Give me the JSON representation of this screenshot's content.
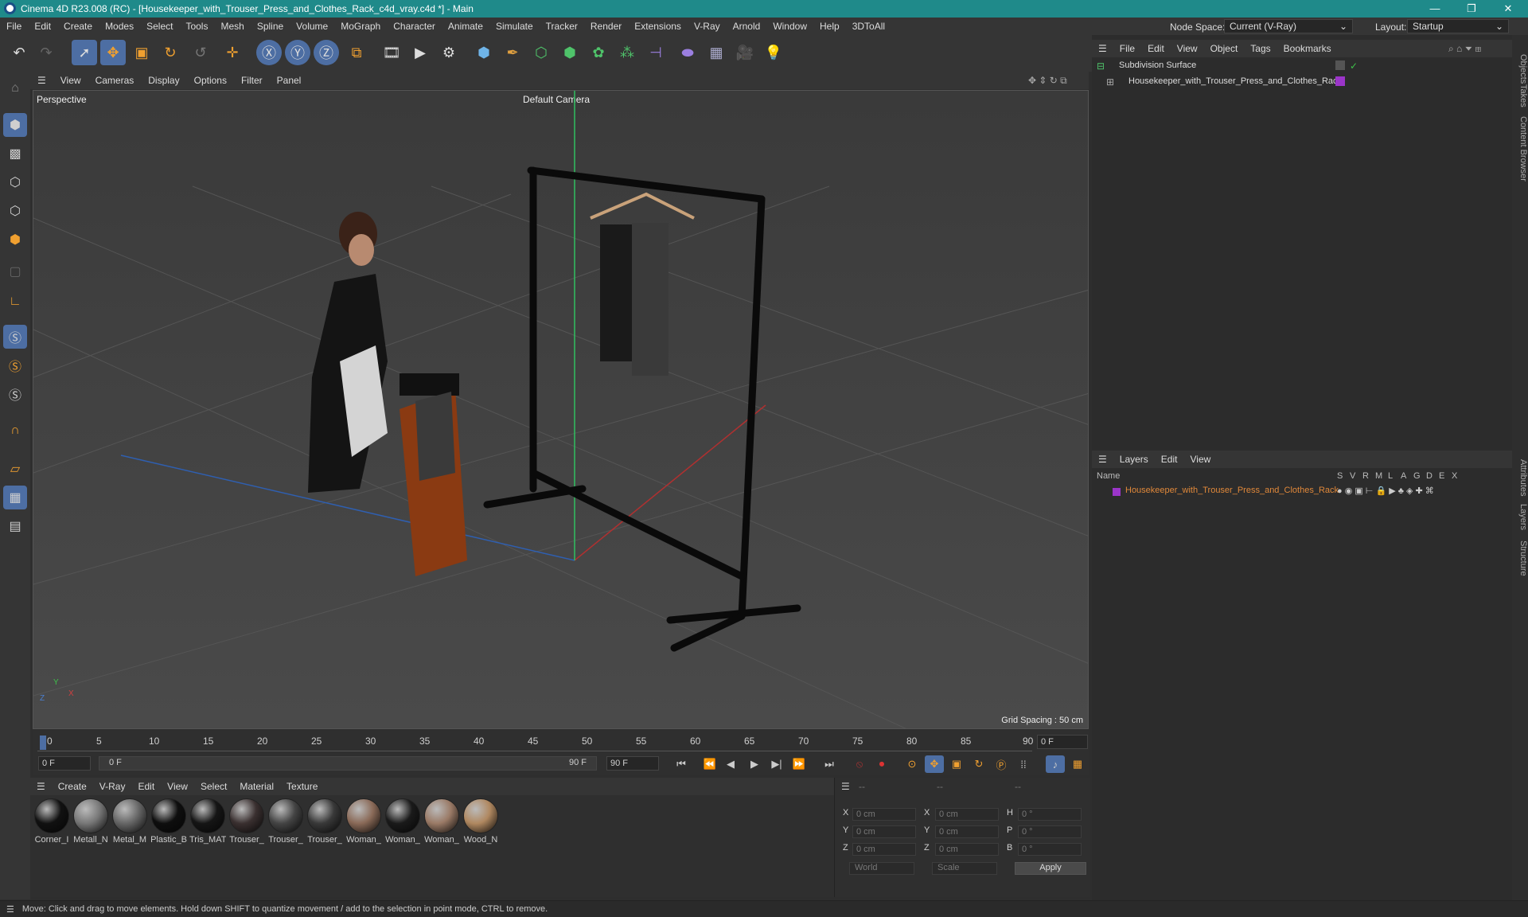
{
  "window": {
    "title": "Cinema 4D R23.008 (RC) - [Housekeeper_with_Trouser_Press_and_Clothes_Rack_c4d_vray.c4d *] - Main",
    "minimize": "—",
    "maximize": "❐",
    "close": "✕"
  },
  "menubar": {
    "items": [
      "File",
      "Edit",
      "Create",
      "Modes",
      "Select",
      "Tools",
      "Mesh",
      "Spline",
      "Volume",
      "MoGraph",
      "Character",
      "Animate",
      "Simulate",
      "Tracker",
      "Render",
      "Extensions",
      "V-Ray",
      "Arnold",
      "Window",
      "Help",
      "3DToAll"
    ],
    "node_space_label": "Node Space:",
    "node_space_value": "Current (V-Ray)",
    "layout_label": "Layout:",
    "layout_value": "Startup"
  },
  "viewport": {
    "menu": [
      "View",
      "Cameras",
      "Display",
      "Options",
      "Filter",
      "Panel"
    ],
    "name": "Perspective",
    "camera": "Default Camera",
    "grid_spacing": "Grid Spacing : 50 cm",
    "axis_y": "Y",
    "axis_x": "X",
    "axis_z": "Z"
  },
  "timeline": {
    "ticks": [
      "0",
      "5",
      "10",
      "15",
      "20",
      "25",
      "30",
      "35",
      "40",
      "45",
      "50",
      "55",
      "60",
      "65",
      "70",
      "75",
      "80",
      "85",
      "90"
    ],
    "current_frame": "0 F",
    "start_frame": "0 F",
    "range_start": "0 F",
    "range_end": "90 F",
    "end_frame": "90 F"
  },
  "materials": {
    "menu": [
      "Create",
      "V-Ray",
      "Edit",
      "View",
      "Select",
      "Material",
      "Texture"
    ],
    "items": [
      {
        "label": "Corner_I",
        "color": "#111"
      },
      {
        "label": "Metall_N",
        "color": "#777"
      },
      {
        "label": "Metal_M",
        "color": "#666"
      },
      {
        "label": "Plastic_B",
        "color": "#0e0e0e"
      },
      {
        "label": "Tris_MAT",
        "color": "#151515"
      },
      {
        "label": "Trouser_",
        "color": "#3a3030"
      },
      {
        "label": "Trouser_",
        "color": "#444"
      },
      {
        "label": "Trouser_",
        "color": "#393939"
      },
      {
        "label": "Woman_",
        "color": "#8a6a58"
      },
      {
        "label": "Woman_",
        "color": "#1a1a1a"
      },
      {
        "label": "Woman_",
        "color": "#9a7a66"
      },
      {
        "label": "Wood_N",
        "color": "#b08860"
      }
    ]
  },
  "coords": {
    "header": [
      "--",
      "--",
      "--"
    ],
    "rows": [
      {
        "a": "X",
        "av": "0 cm",
        "b": "X",
        "bv": "0 cm",
        "c": "H",
        "cv": "0 °"
      },
      {
        "a": "Y",
        "av": "0 cm",
        "b": "Y",
        "bv": "0 cm",
        "c": "P",
        "cv": "0 °"
      },
      {
        "a": "Z",
        "av": "0 cm",
        "b": "Z",
        "bv": "0 cm",
        "c": "B",
        "cv": "0 °"
      }
    ],
    "world": "World",
    "scale": "Scale",
    "apply": "Apply"
  },
  "objects": {
    "menu": [
      "File",
      "Edit",
      "View",
      "Object",
      "Tags",
      "Bookmarks"
    ],
    "items": [
      {
        "label": "Subdivision Surface"
      },
      {
        "label": "Housekeeper_with_Trouser_Press_and_Clothes_Rack"
      }
    ]
  },
  "layers": {
    "menu": [
      "Layers",
      "Edit",
      "View"
    ],
    "col_name": "Name",
    "cols": [
      "S",
      "V",
      "R",
      "M",
      "L",
      "A",
      "G",
      "D",
      "E",
      "X"
    ],
    "row": "Housekeeper_with_Trouser_Press_and_Clothes_Rack",
    "accent": "#e0883a",
    "layer_color": "#9b35c9"
  },
  "sidetabs": [
    "Objects",
    "Takes",
    "Content Browser",
    "Attributes",
    "Layers",
    "Structure"
  ],
  "status": "Move: Click and drag to move elements. Hold down SHIFT to quantize movement / add to the selection in point mode, CTRL to remove."
}
